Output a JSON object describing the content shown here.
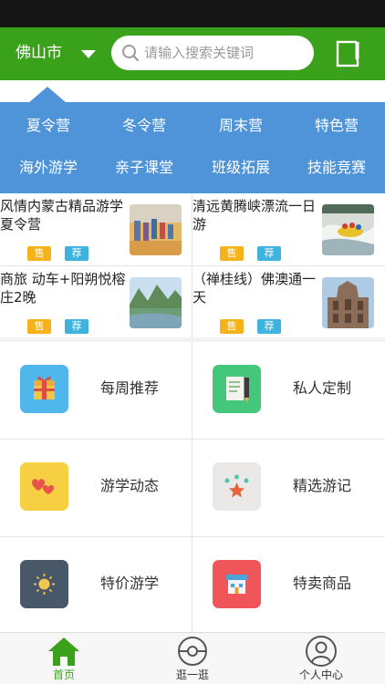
{
  "header": {
    "city": "佛山市",
    "search_placeholder": "请输入搜索关键词"
  },
  "categories": [
    {
      "label": "夏令营"
    },
    {
      "label": "冬令营"
    },
    {
      "label": "周末营"
    },
    {
      "label": "特色营"
    },
    {
      "label": "海外游学"
    },
    {
      "label": "亲子课堂"
    },
    {
      "label": "班级拓展"
    },
    {
      "label": "技能竞赛"
    }
  ],
  "promos": [
    {
      "title": "风情内蒙古精品游学夏令营",
      "tag_sale": "售",
      "tag_recommend": "荐"
    },
    {
      "title": "清远黄腾峡漂流一日游",
      "tag_sale": "售",
      "tag_recommend": "荐"
    },
    {
      "title": "商旅 动车+阳朔悦榕庄2晚",
      "tag_sale": "售",
      "tag_recommend": "荐"
    },
    {
      "title": "（禅桂线）佛澳通一天",
      "tag_sale": "售",
      "tag_recommend": "荐"
    }
  ],
  "features": [
    {
      "label": "每周推荐",
      "icon": "gift-icon",
      "color": "#4fb7ec"
    },
    {
      "label": "私人定制",
      "icon": "notepad-pen-icon",
      "color": "#44c77a"
    },
    {
      "label": "游学动态",
      "icon": "hearts-icon",
      "color": "#f6cf42"
    },
    {
      "label": "精选游记",
      "icon": "star-rating-icon",
      "color": "#ebe8e8"
    },
    {
      "label": "特价游学",
      "icon": "sun-icon",
      "color": "#485868"
    },
    {
      "label": "特卖商品",
      "icon": "shop-icon",
      "color": "#f0555a"
    }
  ],
  "tabbar": [
    {
      "label": "首页",
      "icon": "home-icon",
      "active": true
    },
    {
      "label": "逛一逛",
      "icon": "compass-icon",
      "active": false
    },
    {
      "label": "个人中心",
      "icon": "user-icon",
      "active": false
    }
  ],
  "colors": {
    "brand_green": "#3aa21a",
    "category_blue": "#4f93d8",
    "tag_sale": "#f5b21b",
    "tag_recommend": "#3fb3df"
  }
}
